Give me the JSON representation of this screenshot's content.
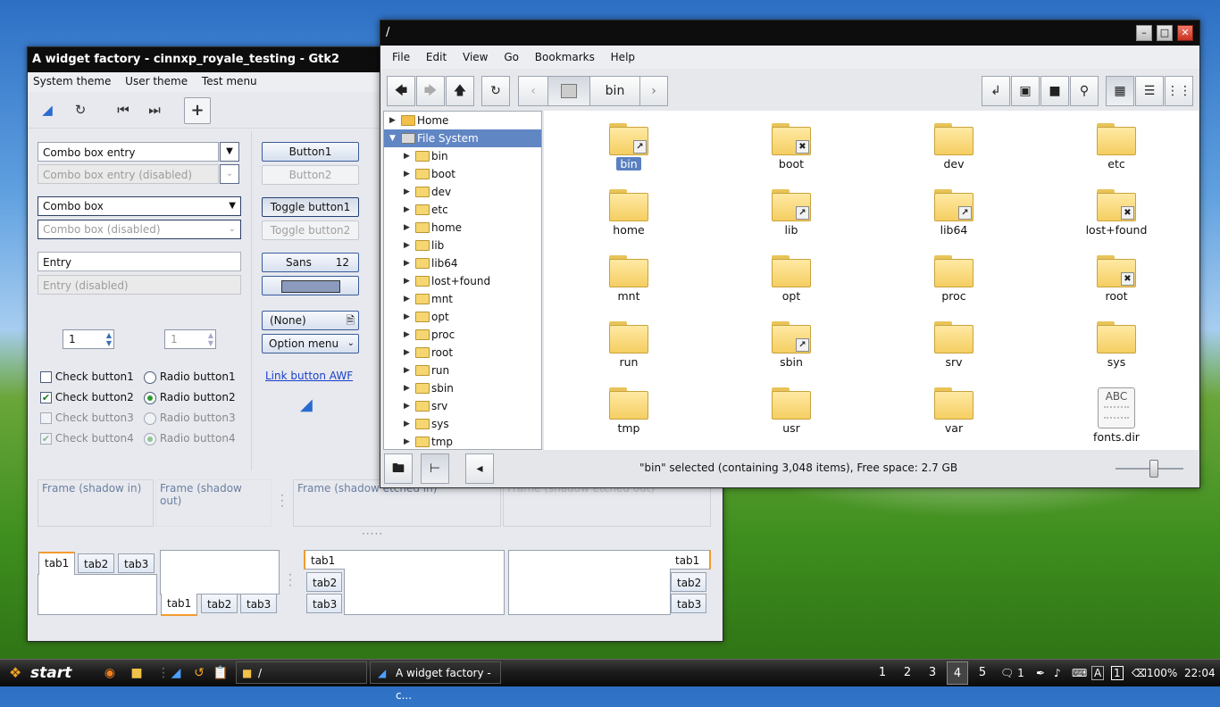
{
  "wf": {
    "title": "A widget factory - cinnxp_royale_testing - Gtk2",
    "menu": [
      "System theme",
      "User theme",
      "Test menu"
    ],
    "combo_entry": "Combo box entry",
    "combo_entry_disabled": "Combo box entry (disabled)",
    "combo_box": "Combo box",
    "combo_box_disabled": "Combo box (disabled)",
    "entry": "Entry",
    "entry_disabled": "Entry (disabled)",
    "spin1": "1",
    "spin2": "1",
    "button1": "Button1",
    "button2": "Button2",
    "toggle1": "Toggle button1",
    "toggle2": "Toggle button2",
    "font_name": "Sans",
    "font_size": "12",
    "color_value": "#8a9bbd",
    "file_chooser": "(None)",
    "option_menu": "Option menu",
    "link": "Link button AWF",
    "check1": "Check button1",
    "check2": "Check button2",
    "check3": "Check button3",
    "check4": "Check button4",
    "radio1": "Radio button1",
    "radio2": "Radio button2",
    "radio3": "Radio button3",
    "radio4": "Radio button4",
    "frame_in": "Frame (shadow in)",
    "frame_out": "Frame (shadow out)",
    "frame_etched_in": "Frame (shadow etched in)",
    "frame_etched_out": "Frame (shadow etched out)",
    "tabs": [
      "tab1",
      "tab2",
      "tab3"
    ]
  },
  "fm": {
    "title": "/",
    "menu": [
      "File",
      "Edit",
      "View",
      "Go",
      "Bookmarks",
      "Help"
    ],
    "path_current": "bin",
    "tree_home": "Home",
    "tree_fs": "File System",
    "tree": [
      "bin",
      "boot",
      "dev",
      "etc",
      "home",
      "lib",
      "lib64",
      "lost+found",
      "mnt",
      "opt",
      "proc",
      "root",
      "run",
      "sbin",
      "srv",
      "sys",
      "tmp"
    ],
    "items": [
      {
        "name": "bin",
        "emblem": "link"
      },
      {
        "name": "boot",
        "emblem": "x"
      },
      {
        "name": "dev",
        "emblem": ""
      },
      {
        "name": "etc",
        "emblem": ""
      },
      {
        "name": "home",
        "emblem": ""
      },
      {
        "name": "lib",
        "emblem": "link"
      },
      {
        "name": "lib64",
        "emblem": "link"
      },
      {
        "name": "lost+found",
        "emblem": "x"
      },
      {
        "name": "mnt",
        "emblem": ""
      },
      {
        "name": "opt",
        "emblem": ""
      },
      {
        "name": "proc",
        "emblem": ""
      },
      {
        "name": "root",
        "emblem": "x"
      },
      {
        "name": "run",
        "emblem": ""
      },
      {
        "name": "sbin",
        "emblem": "link"
      },
      {
        "name": "srv",
        "emblem": ""
      },
      {
        "name": "sys",
        "emblem": ""
      },
      {
        "name": "tmp",
        "emblem": ""
      },
      {
        "name": "usr",
        "emblem": ""
      },
      {
        "name": "var",
        "emblem": ""
      },
      {
        "name": "fonts.dir",
        "emblem": "doc"
      }
    ],
    "doc_label": "ABC",
    "status": "\"bin\" selected (containing 3,048 items), Free space: 2.7 GB",
    "zoom_level": 0.5
  },
  "taskbar": {
    "start": "start",
    "task1": "/",
    "task2": "A widget factory - c...",
    "workspaces": [
      "1",
      "2",
      "3",
      "4",
      "5"
    ],
    "active_workspace": "4",
    "notify_count": "1",
    "battery": "100%",
    "clock": "22:04"
  }
}
